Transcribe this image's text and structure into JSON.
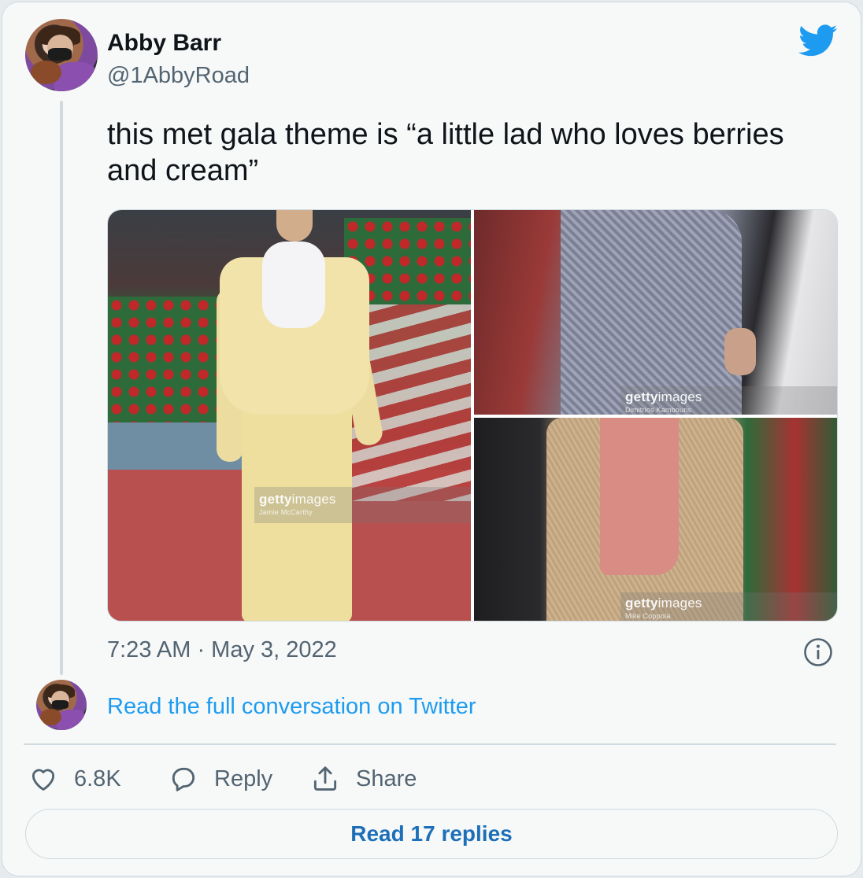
{
  "author": {
    "name": "Abby Barr",
    "handle": "@1AbbyRoad"
  },
  "tweet": {
    "text": "this met gala theme is “a little lad who loves berries and cream”",
    "timestamp": "7:23 AM · May 3, 2022"
  },
  "media": [
    {
      "watermark_brand_bold": "getty",
      "watermark_brand": "images",
      "credit": "Jamie McCarthy"
    },
    {
      "watermark_brand_bold": "getty",
      "watermark_brand": "images",
      "credit": "Dimitrios Kambouris"
    },
    {
      "watermark_brand_bold": "getty",
      "watermark_brand": "images",
      "credit": "Mike Coppola"
    }
  ],
  "conversation_link": "Read the full conversation on Twitter",
  "actions": {
    "likes": "6.8K",
    "reply_label": "Reply",
    "share_label": "Share"
  },
  "replies_button": "Read 17 replies",
  "colors": {
    "link_blue": "#1d9bf0",
    "replies_blue": "#1d6fb8",
    "muted": "#536471",
    "text": "#0f1419",
    "border": "#cfd9de"
  },
  "icons": [
    "twitter-bird-icon",
    "info-icon",
    "heart-icon",
    "reply-bubble-icon",
    "share-upload-icon"
  ]
}
